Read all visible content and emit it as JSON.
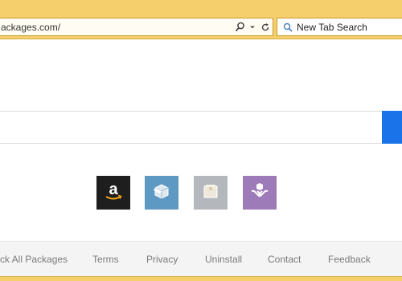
{
  "browser": {
    "address": "ackages.com/",
    "search_placeholder": "New Tab Search"
  },
  "icons": {
    "search": "magnifier-icon",
    "dropdown": "chevron-down-icon",
    "refresh": "refresh-icon"
  },
  "tiles": [
    {
      "name": "amazon",
      "icon": "amazon-logo-icon"
    },
    {
      "name": "package",
      "icon": "box-icon"
    },
    {
      "name": "package-gray",
      "icon": "box-label-icon"
    },
    {
      "name": "delivery",
      "icon": "hand-box-icon"
    }
  ],
  "footer": {
    "links": [
      "ck All Packages",
      "Terms",
      "Privacy",
      "Uninstall",
      "Contact",
      "Feedback"
    ]
  },
  "colors": {
    "chrome": "#f5cf6b",
    "accent_blue": "#1a73e8",
    "amazon_tile": "#1e1e1e",
    "box_tile": "#5e99c4",
    "gray_tile": "#b4b8bc",
    "purple_tile": "#9c7bb8"
  }
}
